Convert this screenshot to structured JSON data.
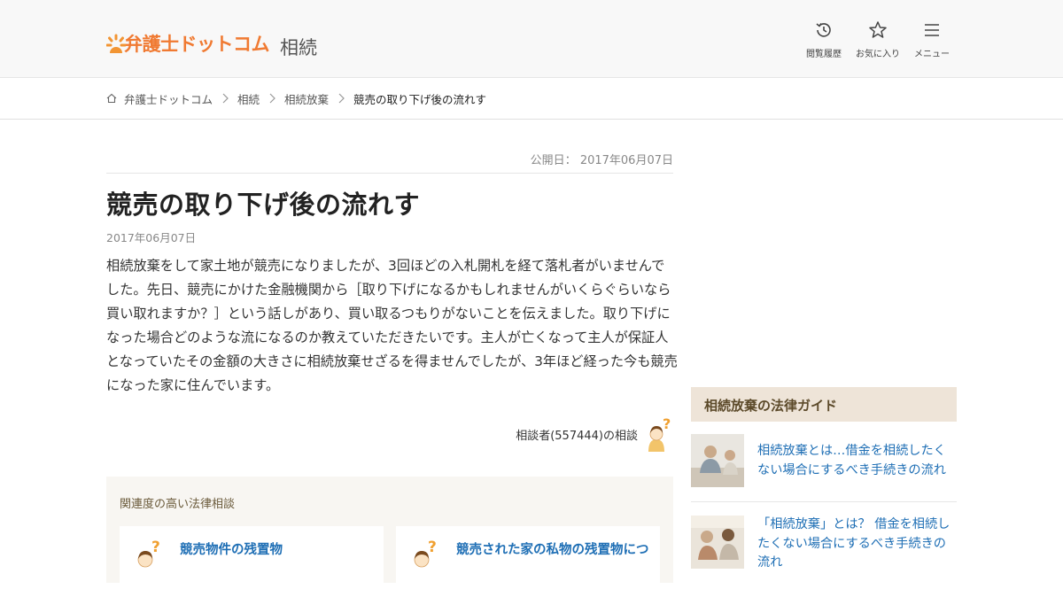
{
  "header": {
    "logo_text": "弁護士ドットコム",
    "logo_sub": "相続",
    "nav": [
      {
        "label": "閲覧履歴",
        "icon": "history-icon"
      },
      {
        "label": "お気に入り",
        "icon": "star-icon"
      },
      {
        "label": "メニュー",
        "icon": "menu-icon"
      }
    ]
  },
  "breadcrumb": {
    "items": [
      "弁護士ドットコム",
      "相続",
      "相続放棄"
    ],
    "current": "競売の取り下げ後の流れす"
  },
  "article": {
    "published_label": "公開日：",
    "published_date": "2017年06月07日",
    "title": "競売の取り下げ後の流れす",
    "date": "2017年06月07日",
    "body": "相続放棄をして家土地が競売になりましたが、3回ほどの入札開札を経て落札者がいませんでした。先日、競売にかけた金融機関から［取り下げになるかもしれませんがいくらぐらいなら買い取れますか？］という話しがあり、買い取るつもりがないことを伝えました。取り下げになった場合どのような流になるのか教えていただきたいです。主人が亡くなって主人が保証人となっていたその金額の大きさに相続放棄せざるを得ませんでしたが、3年ほど経った今も競売になった家に住んでいます。",
    "consultant": "相談者(557444)の相談"
  },
  "related": {
    "title": "関連度の高い法律相談",
    "items": [
      {
        "title": "競売物件の残置物"
      },
      {
        "title": "競売された家の私物の残置物につ"
      }
    ]
  },
  "sidebar": {
    "guide_title": "相続放棄の法律ガイド",
    "items": [
      {
        "title": "相続放棄とは…借金を相続したくない場合にするべき手続きの流れ"
      },
      {
        "title": "「相続放棄」とは？ 借金を相続したくない場合にするべき手続きの流れ"
      }
    ]
  },
  "colors": {
    "brand": "#f07a32",
    "link": "#1f6fb5",
    "guide_bg": "#eee4d8"
  }
}
